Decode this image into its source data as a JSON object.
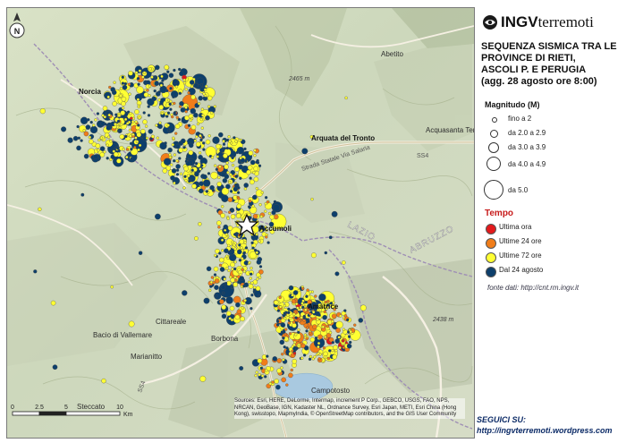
{
  "logo": {
    "brand_bold": "INGV",
    "brand_light": "terremoti",
    "mark_icon": "ingv-globe-icon"
  },
  "title": "SEQUENZA SISMICA TRA LE\nPROVINCE DI RIETI,\nASCOLI P. E PERUGIA\n(agg. 28 agosto ore 8:00)",
  "legend_magnitude": {
    "title": "Magnitudo (M)",
    "items": [
      {
        "label": "fino a 2"
      },
      {
        "label": "da 2.0 a 2.9"
      },
      {
        "label": "da 3.0 a 3.9"
      },
      {
        "label": "da 4.0 a 4.9"
      },
      {
        "label": "da 5.0"
      }
    ]
  },
  "legend_time": {
    "title": "Tempo",
    "items": [
      {
        "label": "Ultima ora",
        "color": "#e31a1c"
      },
      {
        "label": "Ultime 24 ore",
        "color": "#f07d1a"
      },
      {
        "label": "Ultime 72 ore",
        "color": "#ffff33"
      },
      {
        "label": "Dal 24 agosto",
        "color": "#0d3f6b"
      }
    ]
  },
  "source_note": "fonte dati: http://cnt.rm.ingv.it",
  "follow": {
    "label": "SEGUICI SU:",
    "url": "http://ingvterremoti.wordpress.com"
  },
  "attribution": "Sources: Esri, HERE, DeLorme, Intermap, increment P Corp., GEBCO, USGS, FAO, NPS, NRCAN, GeoBase, IGN, Kadaster NL, Ordnance Survey, Esri Japan, METI, Esri China (Hong Kong), swisstopo, MapmyIndia, © OpenStreetMap contributors, and the GIS User Community",
  "scale": {
    "ticks": [
      "0",
      "2.5",
      "5",
      "10"
    ],
    "unit": "Km"
  },
  "north_label": "N",
  "places": [
    {
      "name": "Norcia",
      "bold": true
    },
    {
      "name": "Arquata del Tronto",
      "bold": true
    },
    {
      "name": "Accumoli",
      "bold": true
    },
    {
      "name": "Amatrice",
      "bold": true
    },
    {
      "name": "Abetito",
      "bold": false
    },
    {
      "name": "Acquasanta Terme",
      "bold": false
    },
    {
      "name": "Cittareale",
      "bold": false
    },
    {
      "name": "Marianitto",
      "bold": false
    },
    {
      "name": "Steccato",
      "bold": false
    },
    {
      "name": "Campotosto",
      "bold": false
    },
    {
      "name": "Borbona",
      "bold": false
    },
    {
      "name": "Bacio di Vallemare",
      "bold": false
    }
  ],
  "regions": [
    "LAZIO",
    "ABRUZZO"
  ],
  "roads": [
    "Strada Statale Via Salaria",
    "SS4",
    "SS4"
  ],
  "elevations": [
    "2465 m",
    "2438 m"
  ],
  "epicenter_marker": "epicenter-star-icon"
}
